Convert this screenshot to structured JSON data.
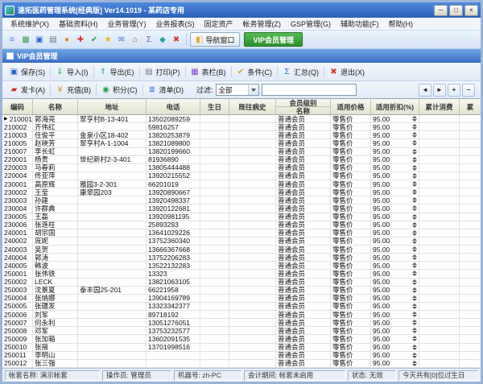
{
  "window": {
    "title": "速拓医药管理系统[经典版] Ver14.1019 - 某药店专用",
    "controls": [
      {
        "name": "minimize-button",
        "glyph": "─"
      },
      {
        "name": "maximize-button",
        "glyph": "□"
      },
      {
        "name": "close-button",
        "glyph": "×"
      }
    ]
  },
  "menu": {
    "items": [
      "系统维护(X)",
      "基础资料(H)",
      "业务管理(Y)",
      "业务报表(S)",
      "固定资产",
      "帐务管理(Z)",
      "GSP管理(G)",
      "辅助功能(F)",
      "帮助(H)"
    ]
  },
  "main_toolbar": {
    "icons": [
      {
        "name": "menu-icon",
        "glyph": "≡",
        "color": "#4A7AC8"
      },
      {
        "name": "inventory-icon",
        "glyph": "▦",
        "color": "#3E9C5A"
      },
      {
        "name": "save-icon",
        "glyph": "▣",
        "color": "#2E62C8"
      },
      {
        "name": "print-icon",
        "glyph": "▤",
        "color": "#6A7686"
      },
      {
        "name": "search-icon",
        "glyph": "●",
        "color": "#D88A1E"
      },
      {
        "name": "add-icon",
        "glyph": "✚",
        "color": "#C83A2E"
      },
      {
        "name": "check-icon",
        "glyph": "✔",
        "color": "#2E9C46"
      },
      {
        "name": "star-icon",
        "glyph": "★",
        "color": "#E8B423"
      },
      {
        "name": "mail-icon",
        "glyph": "✉",
        "color": "#4A7AC8"
      },
      {
        "name": "home-icon",
        "glyph": "⌂",
        "color": "#8A5A2E"
      },
      {
        "name": "summary-icon",
        "glyph": "Σ",
        "color": "#7A4FC8"
      },
      {
        "name": "module-icon",
        "glyph": "◆",
        "color": "#2E9C9C"
      },
      {
        "name": "exit-icon",
        "glyph": "✖",
        "color": "#C83A2E"
      }
    ],
    "nav_window_button": {
      "label": "导航窗口",
      "icon_glyph": "◧"
    },
    "vip_member_button": {
      "label": "VIP会员管理"
    }
  },
  "child_window": {
    "title": "VIP会员管理"
  },
  "doc_toolbar": {
    "buttons": [
      {
        "name": "save-button",
        "icon": "save-icon",
        "label": "保存(S)",
        "glyph": "▣",
        "color": "#2E62C8"
      },
      {
        "name": "import-button",
        "icon": "import-icon",
        "label": "导入(I)",
        "glyph": "⇓",
        "color": "#2E9C46"
      },
      {
        "name": "export-button",
        "icon": "export-icon",
        "label": "导出(E)",
        "glyph": "⇑",
        "color": "#2E9C9C"
      },
      {
        "name": "print-button",
        "icon": "printer-icon",
        "label": "打印(P)",
        "glyph": "▤",
        "color": "#6A7686"
      },
      {
        "name": "columns-button",
        "icon": "table-columns-icon",
        "label": "表栏(B)",
        "glyph": "▦",
        "color": "#7A4FC8"
      },
      {
        "name": "condition-button",
        "icon": "filter-condition-icon",
        "label": "条件(C)",
        "glyph": "✔",
        "color": "#C8A22E"
      },
      {
        "name": "summarize-button",
        "icon": "sigma-icon",
        "label": "汇总(Q)",
        "glyph": "Σ",
        "color": "#2E62C8"
      },
      {
        "name": "exit-button",
        "icon": "exit-icon",
        "label": "退出(X)",
        "glyph": "✖",
        "color": "#C83A2E"
      }
    ]
  },
  "action_toolbar": {
    "buttons": [
      {
        "name": "issue-card-button",
        "icon": "card-icon",
        "label": "发卡(A)",
        "glyph": "▰",
        "color": "#C83A2E"
      },
      {
        "name": "recharge-button",
        "icon": "money-icon",
        "label": "充值(B)",
        "glyph": "¥",
        "color": "#D88A1E"
      },
      {
        "name": "points-button",
        "icon": "points-icon",
        "label": "积分(C)",
        "glyph": "◉",
        "color": "#2E9C46"
      },
      {
        "name": "list-button",
        "icon": "list-icon",
        "label": "清单(D)",
        "glyph": "≣",
        "color": "#2E62C8"
      }
    ],
    "filter_label": "过滤:",
    "filter_select_value": "全部",
    "search_input_value": "",
    "nav_buttons": [
      {
        "name": "prev-record-button",
        "glyph": "◄"
      },
      {
        "name": "next-record-button",
        "glyph": "►"
      },
      {
        "name": "add-record-button",
        "glyph": "+"
      },
      {
        "name": "delete-record-button",
        "glyph": "−"
      }
    ]
  },
  "table": {
    "group_header": "会员级别",
    "columns": [
      "编码",
      "名称",
      "地址",
      "电话",
      "生日",
      "既往病史",
      "名称",
      "适用价格",
      "适用折扣(%)",
      "累计消费",
      "累"
    ],
    "row_common": {
      "member_level": "普通会员",
      "price_type": "零售价",
      "discount_percent": "95.00"
    },
    "selected_row_index": 0,
    "rows": [
      [
        "210001",
        "郭海亮",
        "翠亨村B-13-401",
        "13502089259"
      ],
      [
        "210002",
        "齐伟红",
        "",
        "59816257"
      ],
      [
        "210003",
        "任俊平",
        "金泉小区18-402",
        "13820253879"
      ],
      [
        "210005",
        "赵晓芳",
        "翠亨村A-1-1004",
        "13821089800"
      ],
      [
        "210007",
        "李长虹",
        "",
        "13820199660"
      ],
      [
        "220001",
        "杨贵",
        "世纪新村2-3-401",
        "81936890"
      ],
      [
        "220003",
        "马春莉",
        "",
        "13805444488"
      ],
      [
        "220004",
        "佟亚萍",
        "",
        "13920215552"
      ],
      [
        "230001",
        "高原辉",
        "雅园3-2-301",
        "66201019"
      ],
      [
        "230002",
        "王莹",
        "康翠园203",
        "13920890667"
      ],
      [
        "230003",
        "孙建",
        "",
        "13920498337"
      ],
      [
        "230004",
        "许群典",
        "",
        "13920122681"
      ],
      [
        "230005",
        "王磊",
        "",
        "13920981195"
      ],
      [
        "230006",
        "张连柱",
        "",
        "25893293"
      ],
      [
        "240001",
        "胡宗国",
        "",
        "13641029226"
      ],
      [
        "240002",
        "庞妮",
        "",
        "13752360340"
      ],
      [
        "240003",
        "吴贺",
        "",
        "13666367668"
      ],
      [
        "240004",
        "郭涛",
        "",
        "13752206283"
      ],
      [
        "240005",
        "韩波",
        "",
        "13522132283"
      ],
      [
        "250001",
        "张伟铁",
        "",
        "13323"
      ],
      [
        "250002",
        "LECK",
        "",
        "13821063105"
      ],
      [
        "250003",
        "沈景夏",
        "泰丰园25-201",
        "66221958"
      ],
      [
        "250004",
        "张纳娜",
        "",
        "13904169789"
      ],
      [
        "250005",
        "张疆发",
        "",
        "13323342377"
      ],
      [
        "250006",
        "刘军",
        "",
        "89718192"
      ],
      [
        "250007",
        "何永利",
        "",
        "13051276051"
      ],
      [
        "250008",
        "邓军",
        "",
        "13753232577"
      ],
      [
        "250009",
        "张加箱",
        "",
        "13602091535"
      ],
      [
        "250010",
        "张掖",
        "",
        "13701998516"
      ],
      [
        "250011",
        "李明山",
        "",
        ""
      ],
      [
        "250012",
        "张三强",
        "",
        ""
      ]
    ]
  },
  "status_bar": {
    "panels": [
      "帐套名称: 演示帐套",
      "操作员: 管理员",
      "机器号: zh-PC",
      "会计期间: 帐套未启用",
      "状态: 无效"
    ],
    "birthday_note": "今天共有[0]位过生日"
  }
}
